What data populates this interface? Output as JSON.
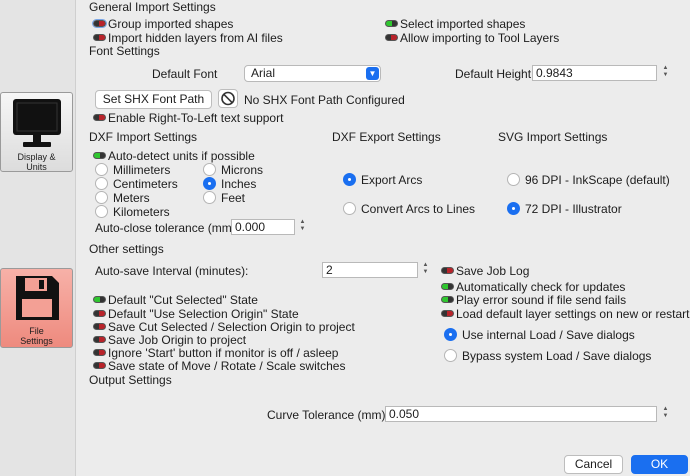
{
  "sidebar": {
    "items": [
      {
        "label_line1": "Display &",
        "label_line2": "Units"
      },
      {
        "label_line1": "File",
        "label_line2": "Settings"
      }
    ]
  },
  "general": {
    "title": "General Import Settings",
    "group_shapes": "Group imported shapes",
    "import_hidden": "Import hidden layers from AI files",
    "select_shapes": "Select imported shapes",
    "allow_tool_layers": "Allow importing to Tool Layers"
  },
  "font": {
    "title": "Font Settings",
    "default_font_label": "Default Font",
    "default_font_value": "Arial",
    "default_height_label": "Default Height",
    "default_height_value": "0.9843",
    "shx_button": "Set SHX Font Path",
    "shx_status": "No SHX Font Path Configured",
    "rtl": "Enable Right-To-Left text support"
  },
  "dxf_import": {
    "title": "DXF Import Settings",
    "auto_detect": "Auto-detect units if possible",
    "units": [
      "Millimeters",
      "Microns",
      "Centimeters",
      "Inches",
      "Meters",
      "Feet",
      "Kilometers"
    ],
    "tolerance_label": "Auto-close tolerance (mm)",
    "tolerance_value": "0.000"
  },
  "dxf_export": {
    "title": "DXF Export Settings",
    "arcs": "Export Arcs",
    "lines": "Convert Arcs to Lines"
  },
  "svg_import": {
    "title": "SVG Import Settings",
    "dpi96": "96 DPI - InkScape (default)",
    "dpi72": "72 DPI - Illustrator"
  },
  "other": {
    "title": "Other settings",
    "autosave_label": "Auto-save Interval (minutes):",
    "autosave_value": "2",
    "save_job_log": "Save Job Log",
    "check_updates": "Automatically check for updates",
    "play_error": "Play error sound if file send fails",
    "load_default_layer": "Load default layer settings on new or restart",
    "cut_selected": "Default \"Cut Selected\" State",
    "use_selection_origin": "Default \"Use Selection Origin\" State",
    "save_cut_selected": "Save Cut Selected / Selection Origin to project",
    "save_job_origin": "Save Job Origin to project",
    "ignore_start": "Ignore 'Start' button if monitor is off / asleep",
    "save_state_switches": "Save state of Move / Rotate / Scale switches",
    "internal_dialogs": "Use internal Load / Save dialogs",
    "bypass_dialogs": "Bypass system Load / Save dialogs"
  },
  "output": {
    "title": "Output Settings",
    "curve_label": "Curve Tolerance (mm)",
    "curve_value": "0.050"
  },
  "footer": {
    "cancel": "Cancel",
    "ok": "OK"
  }
}
